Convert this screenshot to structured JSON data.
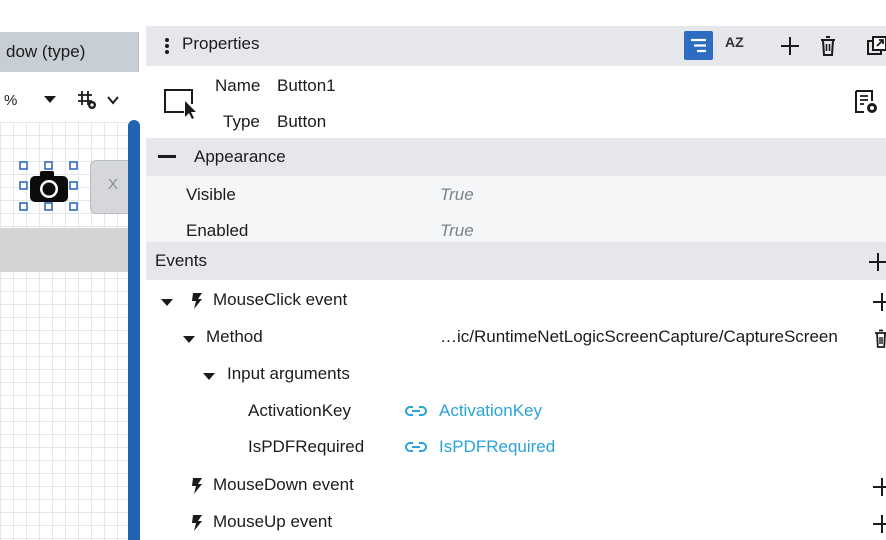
{
  "left_canvas": {
    "doc_tab_label": "dow (type)",
    "zoom_value": "%",
    "zoom_dropdown_icon": "caret-down-icon",
    "grid_settings_icon": "grid-settings-icon",
    "camera_icon": "camera-icon",
    "x_button_label": "X"
  },
  "properties": {
    "title": "Properties",
    "toolbar": {
      "filter_icon": "filter-icon",
      "sort_label": "AZ",
      "add_icon": "plus-icon",
      "delete_icon": "trash-icon",
      "popout_icon": "popout-icon"
    },
    "object": {
      "name_key": "Name",
      "name_value": "Button1",
      "type_key": "Type",
      "type_value": "Button",
      "settings_icon": "document-settings-icon"
    },
    "appearance": {
      "label": "Appearance",
      "rows": [
        {
          "key": "Visible",
          "value": "True"
        },
        {
          "key": "Enabled",
          "value": "True"
        }
      ]
    },
    "events": {
      "label": "Events",
      "mouse_click": {
        "label": "MouseClick event",
        "method_label": "Method",
        "method_value": "…ic/RuntimeNetLogicScreenCapture/CaptureScreen",
        "input_args_label": "Input arguments",
        "args": [
          {
            "key": "ActivationKey",
            "value": "ActivationKey"
          },
          {
            "key": "IsPDFRequired",
            "value": "IsPDFRequired"
          }
        ]
      },
      "mouse_down_label": "MouseDown event",
      "mouse_up_label": "MouseUp event"
    }
  },
  "colors": {
    "accent": "#2d6cc0",
    "splitter": "#1f63b3",
    "link": "#2aa3d8",
    "header_bg": "#e5e7ea"
  }
}
